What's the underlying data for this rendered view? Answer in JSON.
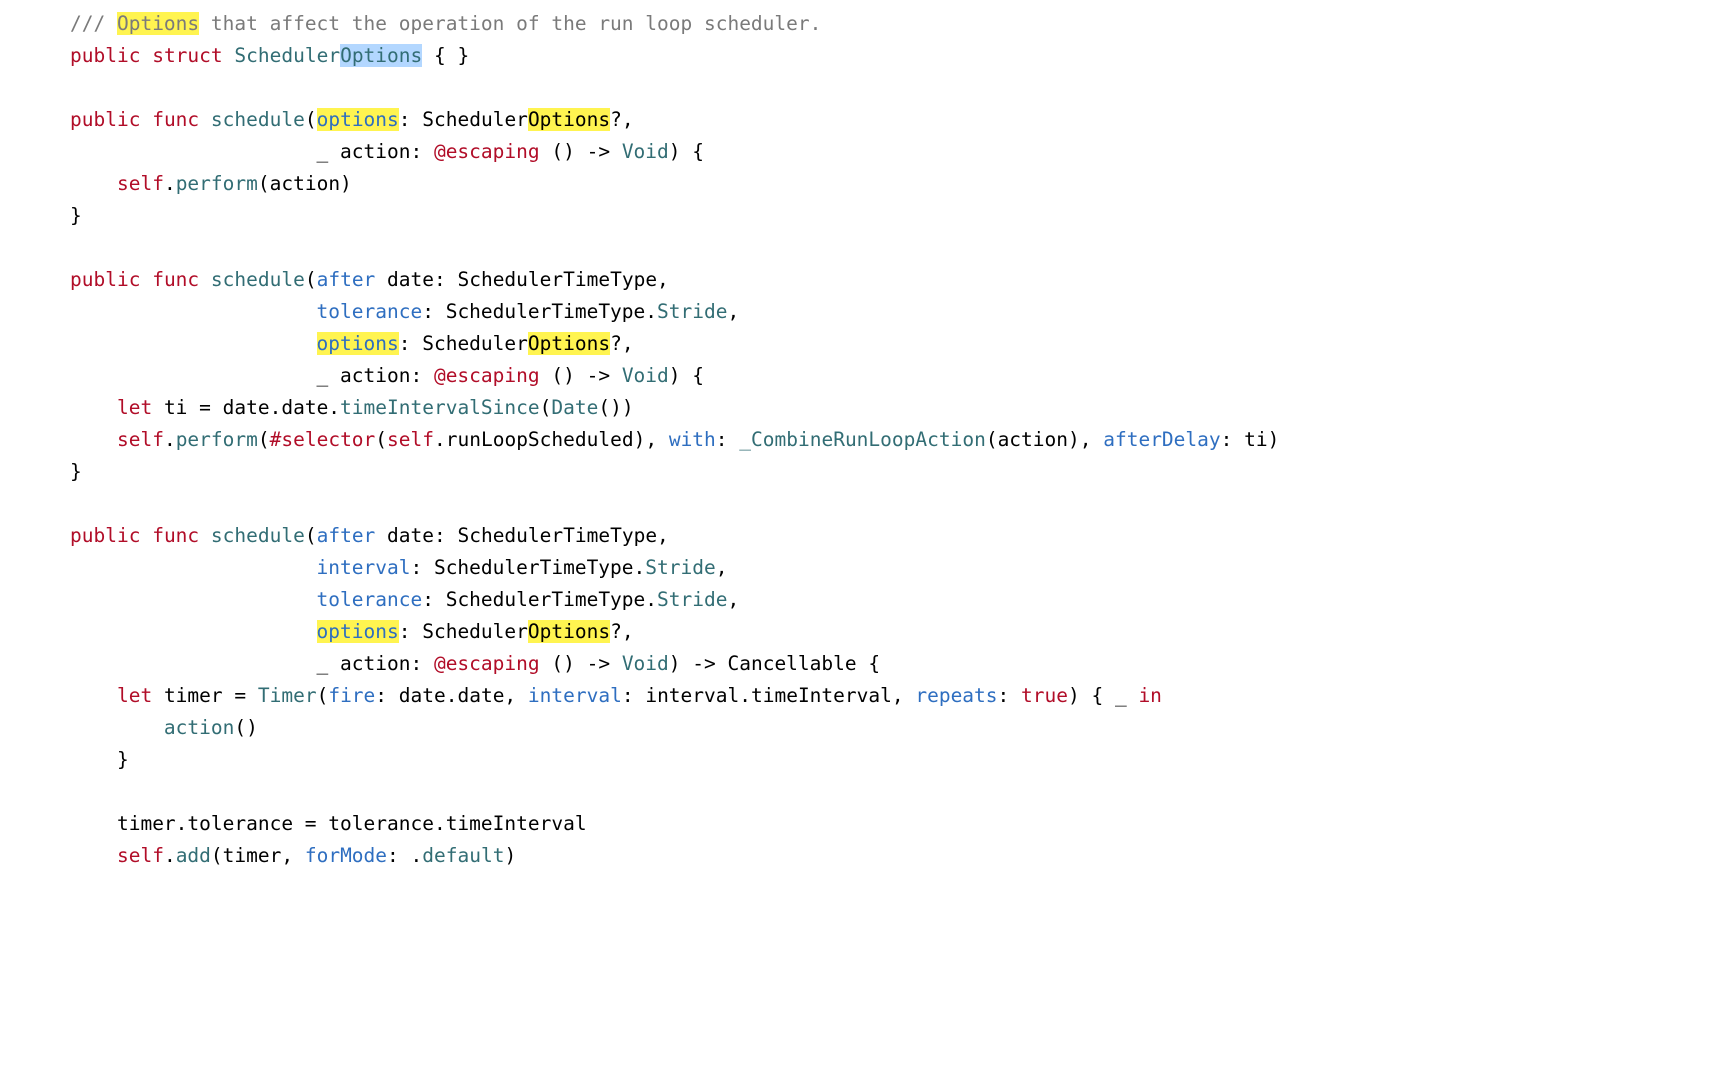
{
  "comment": {
    "prefix": "/// ",
    "hl": "Options",
    "rest": " that affect the operation of the run loop scheduler."
  },
  "line2": {
    "public": "public",
    "struct": "struct",
    "name_pre": "Scheduler",
    "name_hl": "Options",
    "braces": " { }"
  },
  "fn1": {
    "public": "public",
    "func": "func",
    "name": "schedule",
    "options_label": "options",
    "sched": "Scheduler",
    "sched_hl": "Options",
    "qcomma": "?,",
    "action_label": " action: ",
    "escaping": "@escaping",
    "arrow": " () -> ",
    "void": "Void",
    "end": ") {",
    "self": "self",
    "perform": "perform",
    "paren_action": "(action)",
    "close": "}"
  },
  "fn2": {
    "public": "public",
    "func": "func",
    "name": "schedule",
    "after": "after",
    "date_part": " date: SchedulerTimeType,",
    "tolerance_label": "tolerance",
    "tol_rest": ": SchedulerTimeType.",
    "stride": "Stride",
    "options_label": "options",
    "sched": "Scheduler",
    "sched_hl": "Options",
    "qcomma": "?,",
    "action_label": " action: ",
    "escaping": "@escaping",
    "arrow": " () -> ",
    "void": "Void",
    "end": ") {",
    "let": "let",
    "ti_decl": " ti = date.date.",
    "timeIntervalSince": "timeIntervalSince",
    "date_call": "Date",
    "date_suffix": "())",
    "self": "self",
    "perform": "perform",
    "selector": "#selector",
    "sel_inner_pre": "(",
    "sel_self": "self",
    "sel_rest": ".runLoopScheduled), ",
    "with": "with",
    "crla": "_CombineRunLoopAction",
    "crla_args": "(action), ",
    "afterDelay": "afterDelay",
    "ad_rest": ": ti)",
    "close": "}"
  },
  "fn3": {
    "public": "public",
    "func": "func",
    "name": "schedule",
    "after": "after",
    "date_part": " date: SchedulerTimeType,",
    "interval_label": "interval",
    "int_rest": ": SchedulerTimeType.",
    "stride": "Stride",
    "tolerance_label": "tolerance",
    "tol_rest": ": SchedulerTimeType.",
    "options_label": "options",
    "sched": "Scheduler",
    "sched_hl": "Options",
    "qcomma": "?,",
    "action_label": " action: ",
    "escaping": "@escaping",
    "arrow": " () -> ",
    "void": "Void",
    "ret_arrow": ") -> Cancellable {",
    "let": "let",
    "timer_eq": " timer = ",
    "Timer": "Timer",
    "fire": "fire",
    "fire_rest": ": date.date, ",
    "interval2": "interval",
    "int2_rest": ": interval.timeInterval, ",
    "repeats": "repeats",
    "true": "true",
    "closure_end": ") { _ ",
    "in": "in",
    "action_call": "action",
    "action_paren": "()",
    "brace": "}",
    "tol_assign_pre": "timer.tolerance = tolerance.timeInterval",
    "self": "self",
    "add": "add",
    "add_args_pre": "(timer, ",
    "forMode": "forMode",
    "default": "default",
    "add_args_post": ": .",
    "add_close": ")"
  }
}
